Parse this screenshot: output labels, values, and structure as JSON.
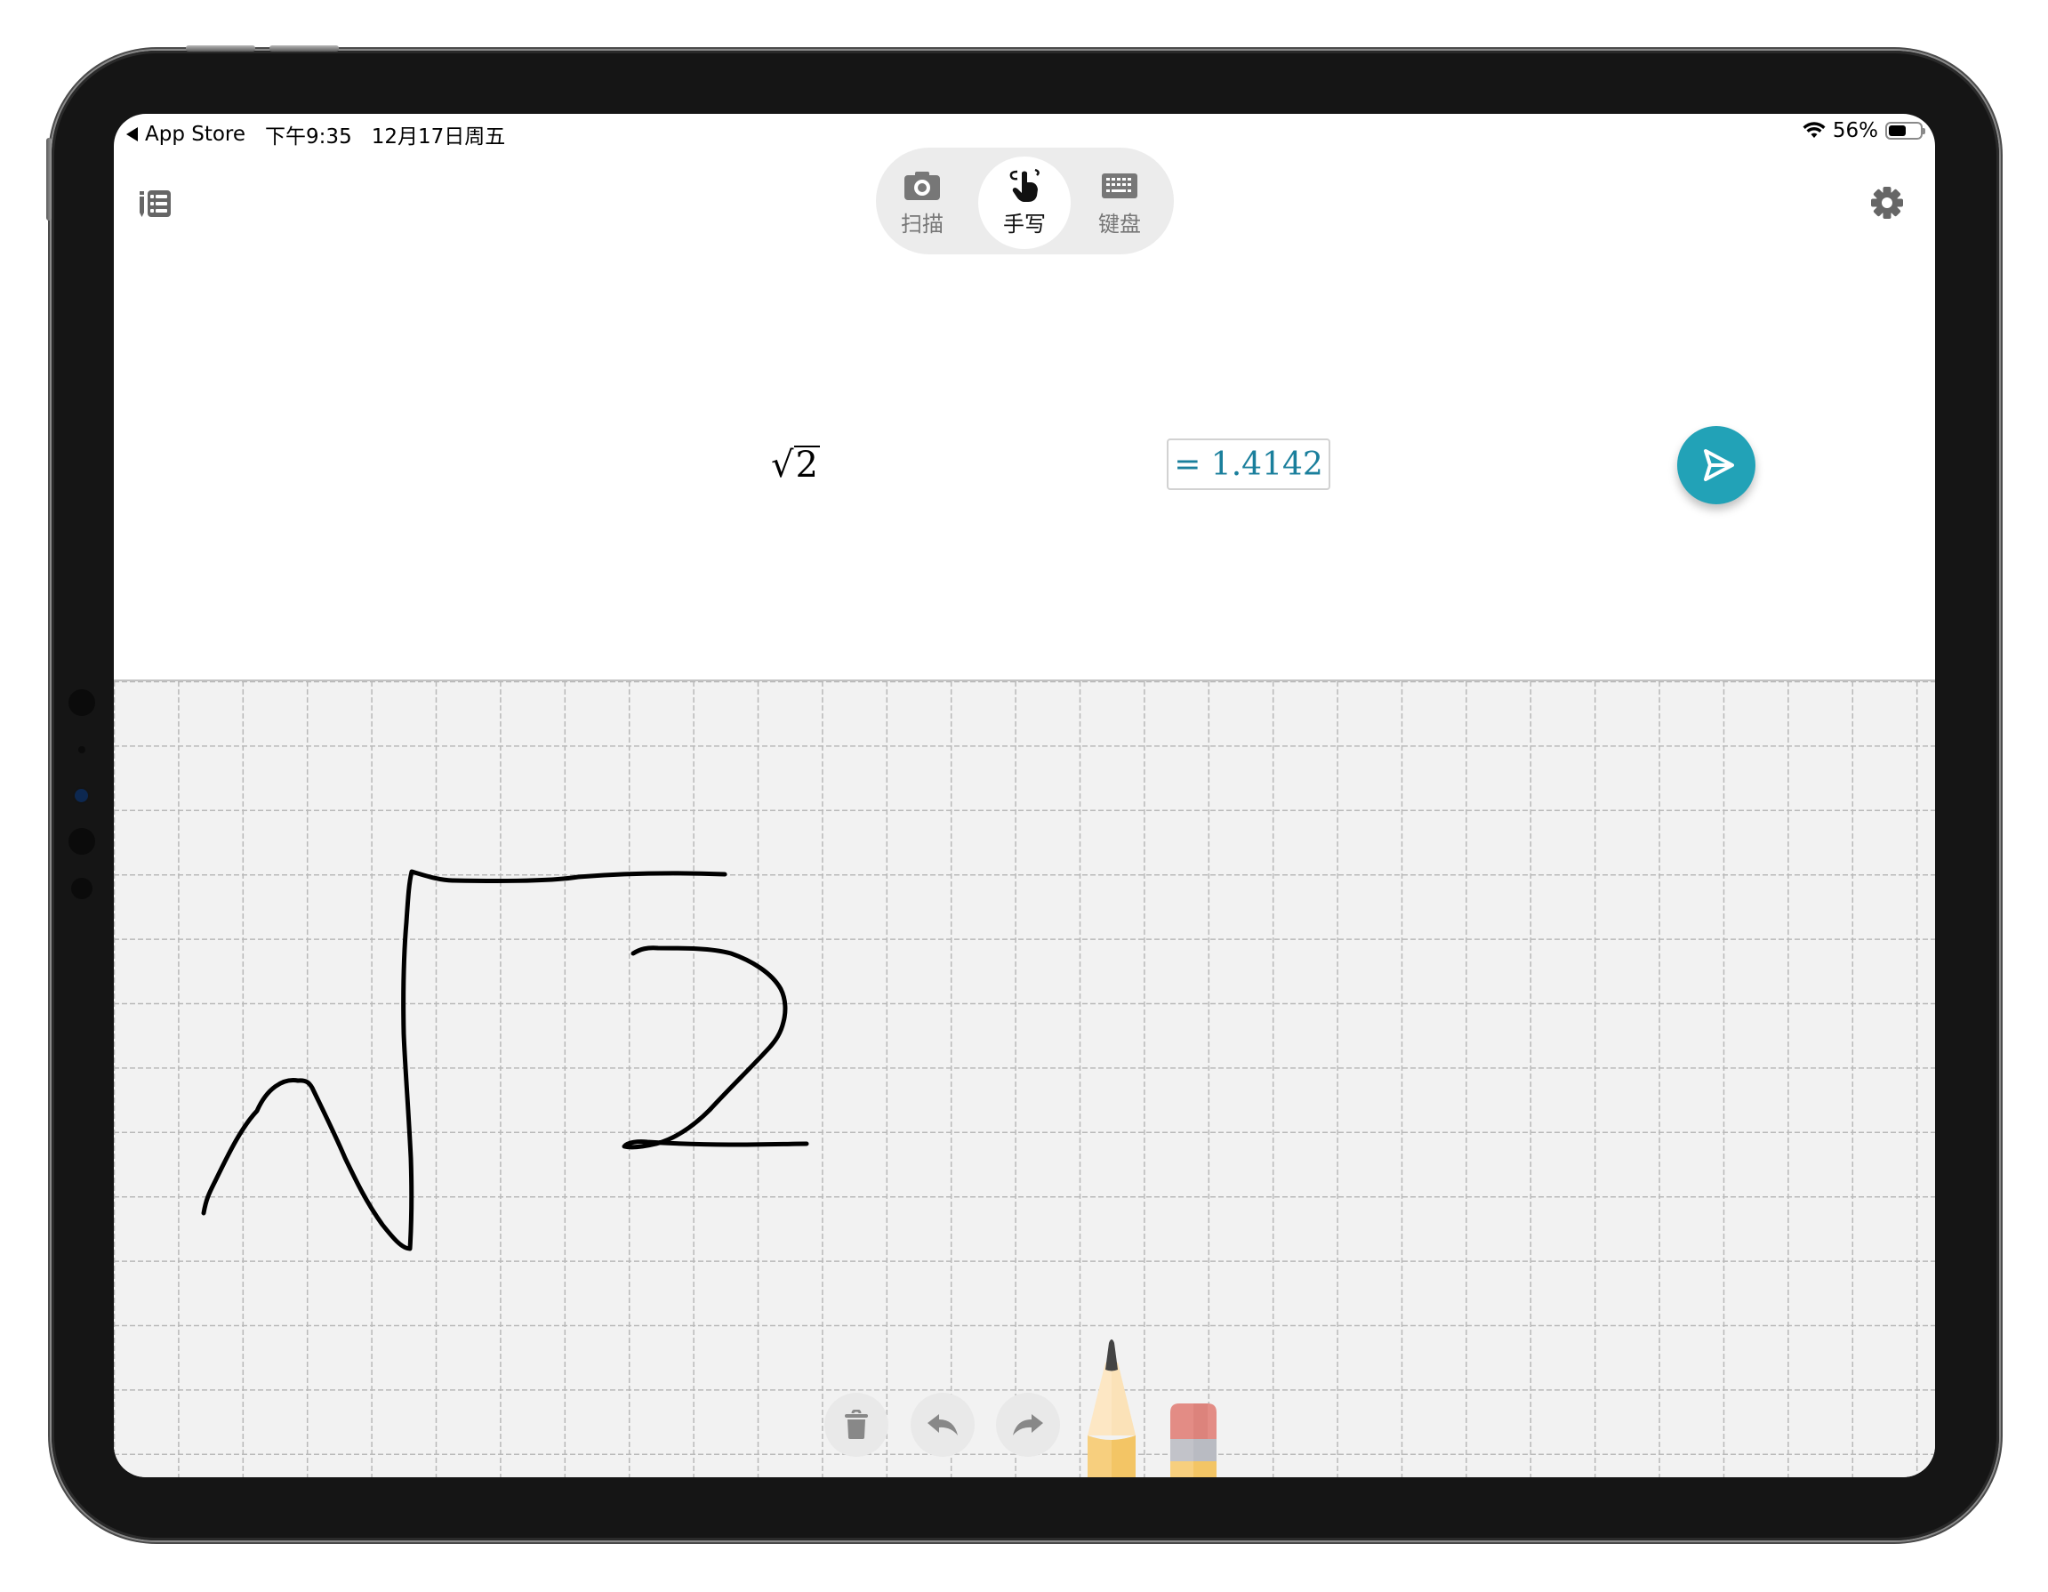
{
  "status_bar": {
    "back_app": "App Store",
    "time": "下午9:35",
    "date": "12月17日周五",
    "battery_percent_label": "56%",
    "battery_level": 0.56,
    "wifi_icon": "wifi-icon"
  },
  "toolbar": {
    "history_icon": "history-list-icon",
    "settings_icon": "gear-icon",
    "modes": [
      {
        "label": "扫描",
        "icon": "camera-icon",
        "active": false
      },
      {
        "label": "手写",
        "icon": "handwriting-finger-icon",
        "active": true
      },
      {
        "label": "键盘",
        "icon": "keyboard-icon",
        "active": false
      }
    ]
  },
  "expression": {
    "radical_symbol": "√",
    "radicand": "2",
    "result": "= 1.4142"
  },
  "send_button": {
    "icon": "send-icon"
  },
  "canvas": {
    "tools": [
      {
        "name": "clear",
        "icon": "trash-icon"
      },
      {
        "name": "undo",
        "icon": "undo-icon"
      },
      {
        "name": "redo",
        "icon": "redo-icon"
      },
      {
        "name": "pencil",
        "icon": "pencil-icon",
        "selected": true
      },
      {
        "name": "eraser",
        "icon": "eraser-icon",
        "selected": false
      }
    ],
    "handwritten_content": "√2"
  },
  "colors": {
    "accent": "#22a2b7",
    "result_text": "#1a7f9c",
    "canvas_bg": "#f2f2f2",
    "grid_line": "#b9b9b9",
    "ink": "#000000"
  }
}
